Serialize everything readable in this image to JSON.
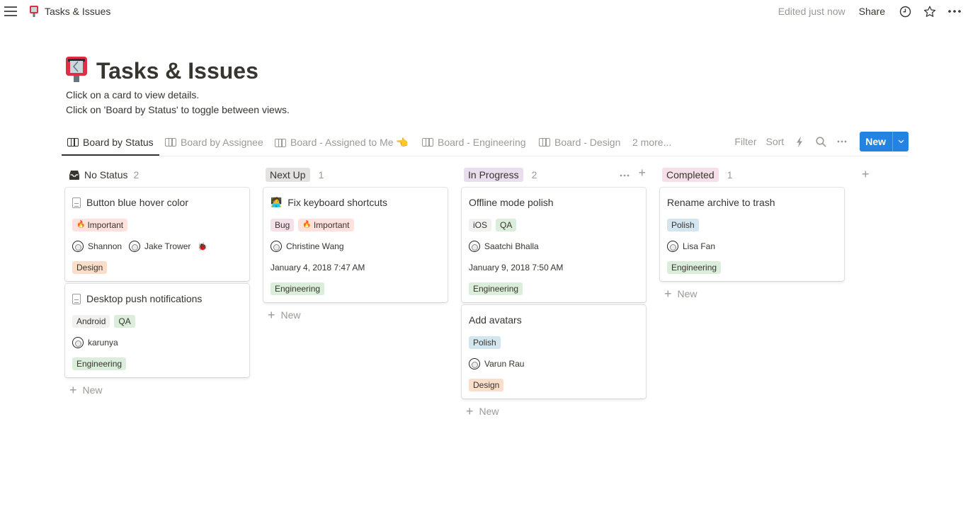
{
  "topbar": {
    "breadcrumb": "Tasks & Issues",
    "edited": "Edited just now",
    "share": "Share"
  },
  "page": {
    "title": "Tasks & Issues",
    "description_lines": [
      "Click on a card to view details.",
      "Click on 'Board by Status' to toggle between views."
    ]
  },
  "views": {
    "tabs": [
      {
        "label": "Board by Status",
        "active": true
      },
      {
        "label": "Board by Assignee",
        "active": false
      },
      {
        "label": "Board - Assigned to Me 👈",
        "active": false
      },
      {
        "label": "Board - Engineering",
        "active": false
      },
      {
        "label": "Board - Design",
        "active": false
      }
    ],
    "more": "2 more...",
    "toolbar": {
      "filter": "Filter",
      "sort": "Sort",
      "new": "New"
    }
  },
  "colors": {
    "accent": "#2383e2",
    "tag_important": "#ffe2dd",
    "tag_design": "#fadec9",
    "tag_engineering": "#dbeddb",
    "tag_qa": "#dbeddb",
    "tag_android": "#f1f1ef",
    "tag_ios": "#f1f1ef",
    "tag_bug": "#f5e0e9",
    "tag_polish": "#d3e5ef",
    "status_next_up": "#e3e2e0",
    "status_in_progress": "#e8deee",
    "status_completed": "#f5e0e9"
  },
  "board": {
    "new_label": "New",
    "columns": [
      {
        "title": "No Status",
        "count": "2",
        "cards": [
          {
            "title": "Button blue hover color",
            "icon": "document-icon",
            "tags": [
              {
                "label": "Important",
                "emoji": "🔥"
              }
            ],
            "people": [
              "Shannon",
              "Jake Trower"
            ],
            "people_extra": "🐞",
            "team": "Design"
          },
          {
            "title": "Desktop push notifications",
            "icon": "document-icon",
            "tags": [
              {
                "label": "Android"
              },
              {
                "label": "QA"
              }
            ],
            "people": [
              "karunya"
            ],
            "team": "Engineering"
          }
        ]
      },
      {
        "title": "Next Up",
        "count": "1",
        "cards": [
          {
            "title": "Fix keyboard shortcuts",
            "icon": "technologist-emoji",
            "emoji": "🧑‍💻",
            "tags": [
              {
                "label": "Bug"
              },
              {
                "label": "Important",
                "emoji": "🔥"
              }
            ],
            "people": [
              "Christine Wang"
            ],
            "date": "January 4, 2018 7:47 AM",
            "team": "Engineering"
          }
        ]
      },
      {
        "title": "In Progress",
        "count": "2",
        "cards": [
          {
            "title": "Offline mode polish",
            "tags": [
              {
                "label": "iOS"
              },
              {
                "label": "QA"
              }
            ],
            "people": [
              "Saatchi Bhalla"
            ],
            "date": "January 9, 2018 7:50 AM",
            "team": "Engineering"
          },
          {
            "title": "Add avatars",
            "tags": [
              {
                "label": "Polish"
              }
            ],
            "people": [
              "Varun Rau"
            ],
            "team": "Design"
          }
        ]
      },
      {
        "title": "Completed",
        "count": "1",
        "cards": [
          {
            "title": "Rename archive to trash",
            "tags": [
              {
                "label": "Polish"
              }
            ],
            "people": [
              "Lisa Fan"
            ],
            "team": "Engineering"
          }
        ]
      }
    ]
  }
}
